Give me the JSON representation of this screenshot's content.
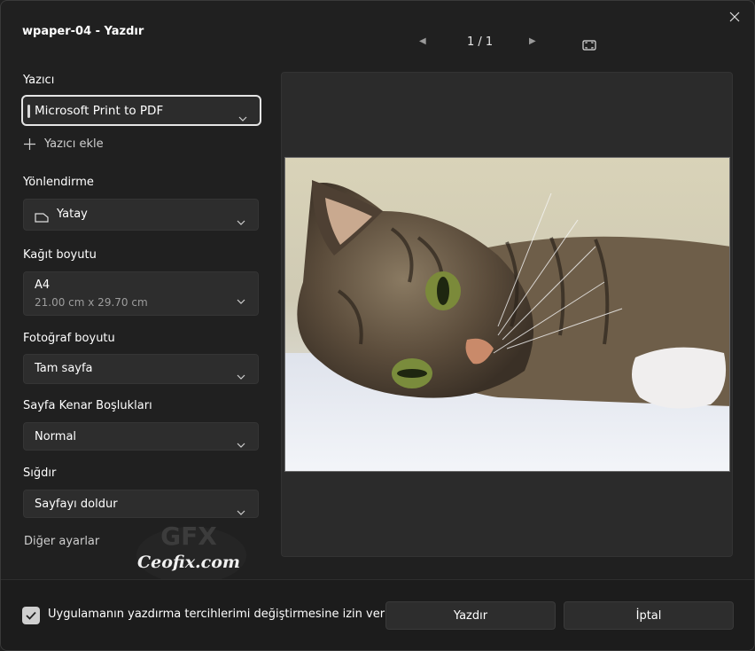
{
  "window": {
    "title": "wpaper-04 - Yazdır"
  },
  "pager": {
    "count": "1 / 1"
  },
  "printer": {
    "label": "Yazıcı",
    "value": "Microsoft Print to PDF",
    "add_label": "Yazıcı ekle"
  },
  "orientation": {
    "label": "Yönlendirme",
    "value": "Yatay"
  },
  "paper": {
    "label": "Kağıt boyutu",
    "value": "A4",
    "size": "21.00 cm x 29.70 cm"
  },
  "photo_size": {
    "label": "Fotoğraf boyutu",
    "value": "Tam sayfa"
  },
  "margins": {
    "label": "Sayfa Kenar Boşlukları",
    "value": "Normal"
  },
  "fit": {
    "label": "Sığdır",
    "value": "Sayfayı doldur"
  },
  "more_settings": "Diğer ayarlar",
  "footer": {
    "checkbox_label": "Uygulamanın yazdırma tercihlerimi değiştirmesine izin ver",
    "checked": true,
    "print_label": "Yazdır",
    "cancel_label": "İptal"
  },
  "watermark": {
    "line1": "GFX",
    "line2": "Ceofix.com"
  },
  "colors": {
    "window_bg": "#202020",
    "control_bg": "#2d2d2d",
    "preview_bg": "#2b2b2b",
    "focus_border": "#e5e5e5"
  }
}
